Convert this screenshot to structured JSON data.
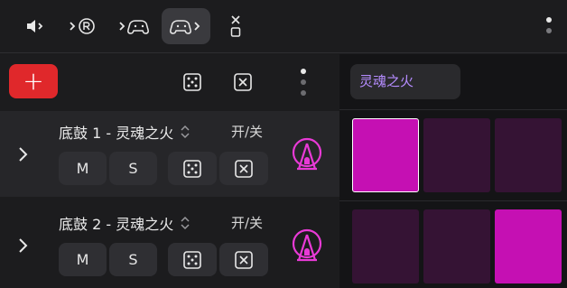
{
  "colors": {
    "accent_add": "#e0282b",
    "pattern_tab_text": "#b58cff",
    "step_on": "#c510b3",
    "step_off": "#351334",
    "ferris_icon": "#e83ad6"
  },
  "toolbar": {
    "buttons": [
      {
        "icon": "speaker-arrow-icon",
        "active": false
      },
      {
        "icon": "registered-arrow-icon",
        "active": false
      },
      {
        "icon": "gamepad-arrow-icon",
        "active": false
      },
      {
        "icon": "gamepad-arrow-out-icon",
        "active": true
      },
      {
        "icon": "x-stack-icon",
        "active": false
      }
    ],
    "more_icon": "vertical-dots-icon"
  },
  "header": {
    "add_label": "+",
    "randomize_icon": "dice-icon",
    "clear_icon": "square-x-icon",
    "more_icon": "vertical-dots-icon"
  },
  "pattern": {
    "name": "灵魂之火"
  },
  "tracks": [
    {
      "name": "底鼓 1 - 灵魂之火",
      "onoff_label": "开/关",
      "mute_label": "M",
      "solo_label": "S",
      "selected": true,
      "steps": [
        {
          "on": true,
          "selected": true
        },
        {
          "on": false,
          "selected": false
        },
        {
          "on": false,
          "selected": false
        }
      ]
    },
    {
      "name": "底鼓 2 - 灵魂之火",
      "onoff_label": "开/关",
      "mute_label": "M",
      "solo_label": "S",
      "selected": false,
      "steps": [
        {
          "on": false,
          "selected": false
        },
        {
          "on": false,
          "selected": false
        },
        {
          "on": true,
          "selected": false
        }
      ]
    }
  ]
}
